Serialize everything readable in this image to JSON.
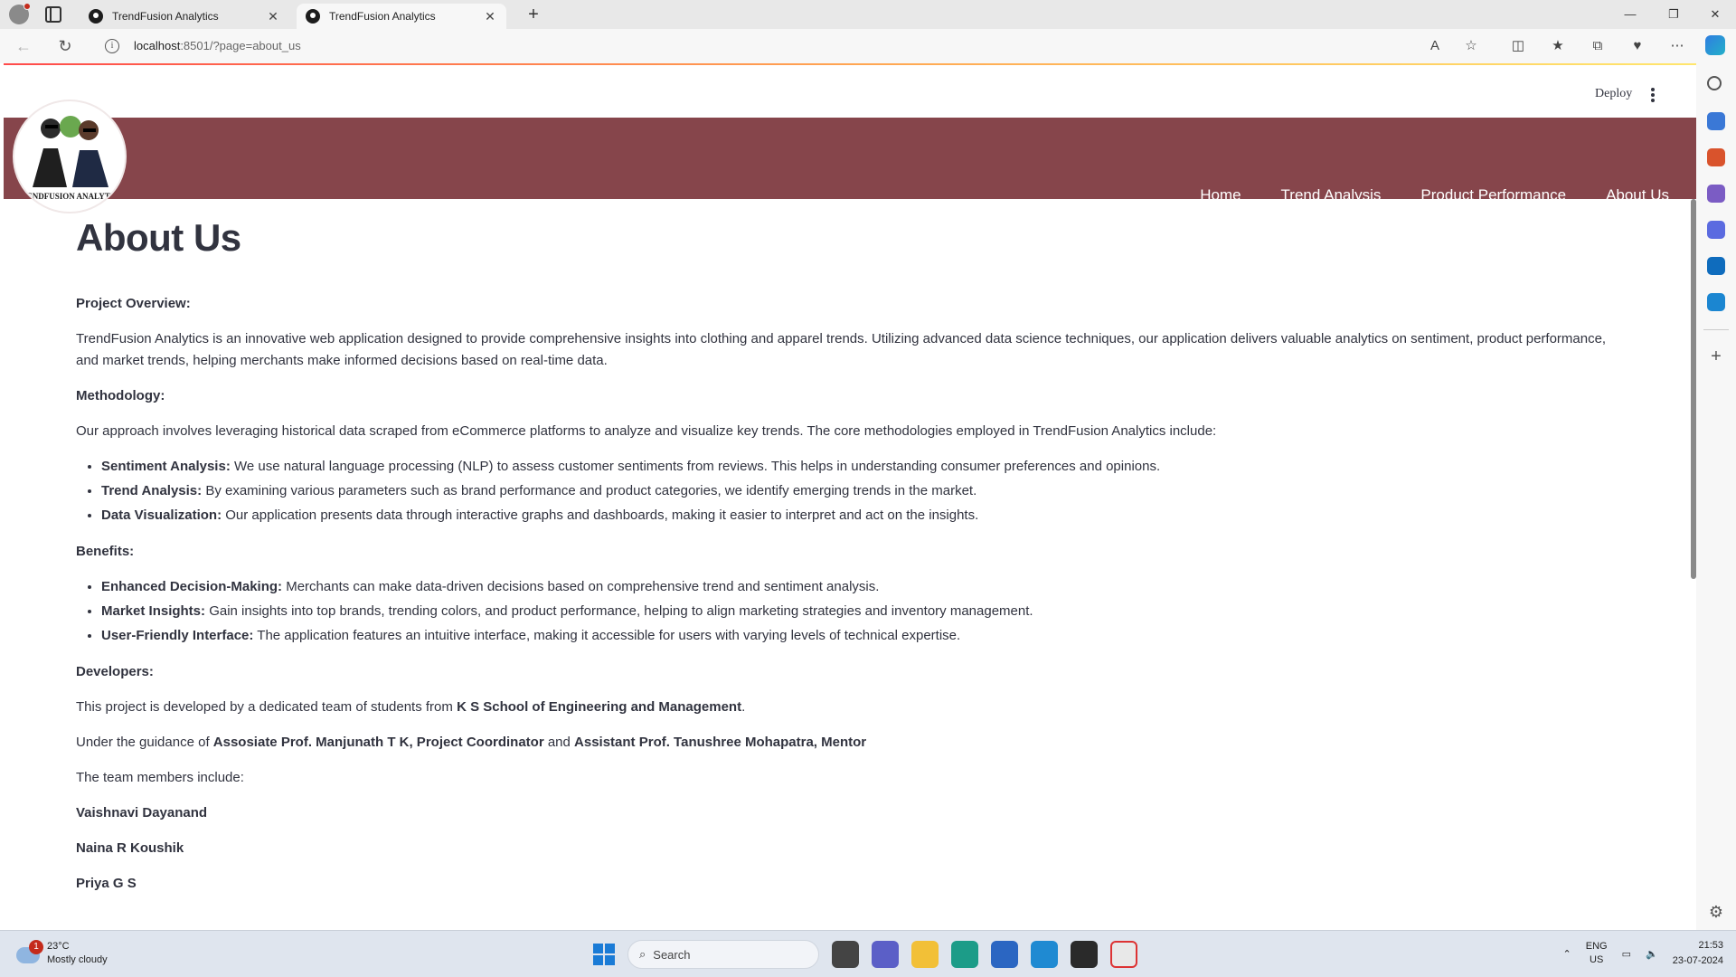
{
  "browser": {
    "tabs": [
      {
        "title": "TrendFusion Analytics",
        "active": false
      },
      {
        "title": "TrendFusion Analytics",
        "active": true
      }
    ],
    "url_host": "localhost",
    "url_rest": ":8501/?page=about_us"
  },
  "streamlit": {
    "deploy_label": "Deploy"
  },
  "navbar": {
    "logo_text": "TRENDFUSION ANALYTICS",
    "links": [
      "Home",
      "Trend Analysis",
      "Product Performance",
      "About Us"
    ],
    "color": "#86454b"
  },
  "content": {
    "title": "About Us",
    "overview_heading": "Project Overview:",
    "overview_text": "TrendFusion Analytics is an innovative web application designed to provide comprehensive insights into clothing and apparel trends. Utilizing advanced data science techniques, our application delivers valuable analytics on sentiment, product performance, and market trends, helping merchants make informed decisions based on real-time data.",
    "methodology_heading": "Methodology:",
    "methodology_intro": "Our approach involves leveraging historical data scraped from eCommerce platforms to analyze and visualize key trends. The core methodologies employed in TrendFusion Analytics include:",
    "methods": [
      {
        "label": "Sentiment Analysis:",
        "text": " We use natural language processing (NLP) to assess customer sentiments from reviews. This helps in understanding consumer preferences and opinions."
      },
      {
        "label": "Trend Analysis:",
        "text": " By examining various parameters such as brand performance and product categories, we identify emerging trends in the market."
      },
      {
        "label": "Data Visualization:",
        "text": " Our application presents data through interactive graphs and dashboards, making it easier to interpret and act on the insights."
      }
    ],
    "benefits_heading": "Benefits:",
    "benefits": [
      {
        "label": "Enhanced Decision-Making:",
        "text": " Merchants can make data-driven decisions based on comprehensive trend and sentiment analysis."
      },
      {
        "label": "Market Insights:",
        "text": " Gain insights into top brands, trending colors, and product performance, helping to align marketing strategies and inventory management."
      },
      {
        "label": "User-Friendly Interface:",
        "text": " The application features an intuitive interface, making it accessible for users with varying levels of technical expertise."
      }
    ],
    "developers_heading": "Developers:",
    "dev_text_pre": "This project is developed by a dedicated team of students from ",
    "dev_school": "K S School of Engineering and Management",
    "dev_text_post": ".",
    "guidance_pre": "Under the guidance of ",
    "guidance_1": "Assosiate Prof. Manjunath T K, Project Coordinator",
    "guidance_mid": " and ",
    "guidance_2": "Assistant Prof. Tanushree Mohapatra, Mentor",
    "team_intro": "The team members include:",
    "team": [
      "Vaishnavi Dayanand",
      "Naina R Koushik",
      "Priya G S"
    ]
  },
  "taskbar": {
    "weather_temp": "23°C",
    "weather_desc": "Mostly cloudy",
    "weather_badge": "1",
    "search_placeholder": "Search",
    "lang_1": "ENG",
    "lang_2": "US",
    "time": "21:53",
    "date": "23-07-2024"
  }
}
